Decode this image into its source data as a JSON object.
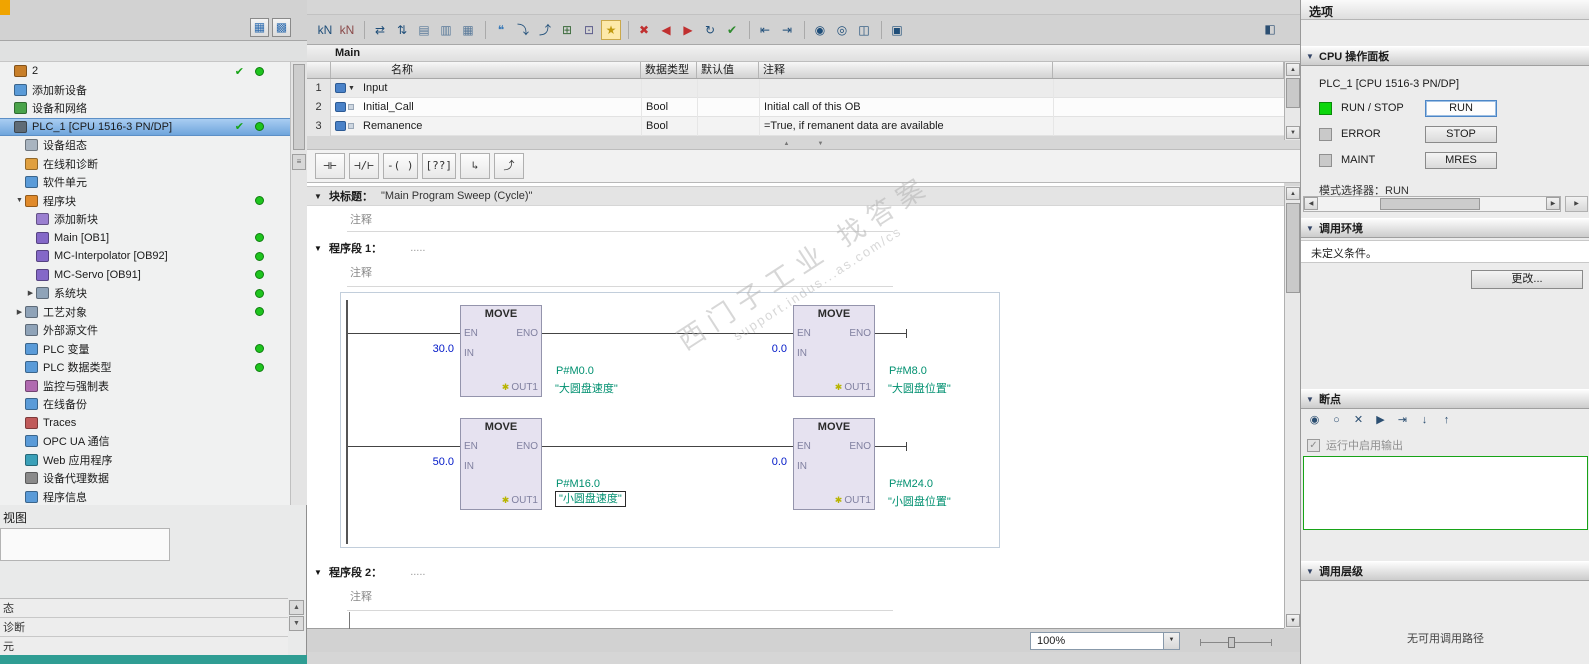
{
  "colors": {
    "accent_green": "#1ec41e",
    "selection_blue": "#6fa5dc",
    "operand_green": "#009070",
    "value_blue": "#0018c8",
    "block_fill": "#e6e2f0"
  },
  "left_panel": {
    "top_buttons": [
      {
        "name": "detail-view-toggle-button",
        "glyph": "▦"
      },
      {
        "name": "overview-toggle-button",
        "glyph": "▩"
      }
    ],
    "tree_items": [
      {
        "id": "project-root",
        "label": "2",
        "icon": "project",
        "indent": 0,
        "check": true,
        "dot": true
      },
      {
        "id": "add-new-device",
        "label": "添加新设备",
        "icon": "add-device",
        "indent": 0
      },
      {
        "id": "devices-networks",
        "label": "设备和网络",
        "icon": "network",
        "indent": 0
      },
      {
        "id": "plc-1",
        "label": "PLC_1 [CPU 1516-3 PN/DP]",
        "icon": "plc",
        "indent": 0,
        "selected": true,
        "check": true,
        "dot": true
      },
      {
        "id": "device-configuration",
        "label": "设备组态",
        "icon": "config",
        "indent": 1
      },
      {
        "id": "online-diagnostics",
        "label": "在线和诊断",
        "icon": "diag",
        "indent": 1
      },
      {
        "id": "software-units",
        "label": "软件单元",
        "icon": "unit",
        "indent": 1
      },
      {
        "id": "program-blocks",
        "label": "程序块",
        "icon": "folder-blocks",
        "indent": 1,
        "dot": true,
        "exp": "▼"
      },
      {
        "id": "add-new-block",
        "label": "添加新块",
        "icon": "add-block",
        "indent": 2
      },
      {
        "id": "main-ob1",
        "label": "Main [OB1]",
        "icon": "ob",
        "indent": 2,
        "dot": true
      },
      {
        "id": "mc-interpolator-ob92",
        "label": "MC-Interpolator [OB92]",
        "icon": "ob",
        "indent": 2,
        "dot": true
      },
      {
        "id": "mc-servo-ob91",
        "label": "MC-Servo [OB91]",
        "icon": "ob",
        "indent": 2,
        "dot": true
      },
      {
        "id": "system-blocks",
        "label": "系统块",
        "icon": "folder",
        "indent": 2,
        "dot": true,
        "exp": "▶"
      },
      {
        "id": "technology-objects",
        "label": "工艺对象",
        "icon": "folder-tech",
        "indent": 1,
        "dot": true,
        "exp": "▶"
      },
      {
        "id": "external-source-files",
        "label": "外部源文件",
        "icon": "folder-src",
        "indent": 1
      },
      {
        "id": "plc-tags",
        "label": "PLC 变量",
        "icon": "tags",
        "indent": 1,
        "dot": true
      },
      {
        "id": "plc-data-types",
        "label": "PLC 数据类型",
        "icon": "types",
        "indent": 1,
        "dot": true
      },
      {
        "id": "watch-force-tables",
        "label": "监控与强制表",
        "icon": "watch",
        "indent": 1
      },
      {
        "id": "online-backups",
        "label": "在线备份",
        "icon": "backup",
        "indent": 1
      },
      {
        "id": "traces",
        "label": "Traces",
        "icon": "traces",
        "indent": 1
      },
      {
        "id": "opc-ua-communication",
        "label": "OPC UA 通信",
        "icon": "opcua",
        "indent": 1
      },
      {
        "id": "web-applications",
        "label": "Web 应用程序",
        "icon": "web",
        "indent": 1
      },
      {
        "id": "device-proxy-data",
        "label": "设备代理数据",
        "icon": "proxy",
        "indent": 1
      },
      {
        "id": "program-info",
        "label": "程序信息",
        "icon": "info",
        "indent": 1
      }
    ],
    "detail_view_label": "视图",
    "bottom_rows": [
      "态",
      "诊断",
      "元"
    ]
  },
  "editor": {
    "title": "Main",
    "toolbar_icons": [
      {
        "name": "keep-actual-values-icon",
        "glyph": "kN",
        "color": "#1f4e79"
      },
      {
        "name": "discard-actual-values-icon",
        "glyph": "kN",
        "color": "#8a4a4a"
      },
      {
        "sep": true
      },
      {
        "name": "copy-snapshots-icon",
        "glyph": "⇄",
        "color": "#1f4e79"
      },
      {
        "name": "load-start-values-icon",
        "glyph": "⇅",
        "color": "#1f4e79"
      },
      {
        "name": "insert-row-icon",
        "glyph": "▤",
        "color": "#5a7a9a"
      },
      {
        "name": "add-row-icon",
        "glyph": "▥",
        "color": "#5a7a9a"
      },
      {
        "name": "absolute-symbolic-icon",
        "glyph": "▦",
        "color": "#5a7a9a"
      },
      {
        "sep": true
      },
      {
        "name": "comment-icon",
        "glyph": "❝",
        "color": "#3a7ab8"
      },
      {
        "name": "open-branch-icon",
        "glyph": "⤵",
        "color": "#1f4e79"
      },
      {
        "name": "close-branch-icon",
        "glyph": "⤴",
        "color": "#1f4e79"
      },
      {
        "name": "insert-network-icon",
        "glyph": "⊞",
        "color": "#3a6a3a"
      },
      {
        "name": "insert-empty-box-icon",
        "glyph": "⊡",
        "color": "#5a5a8a"
      },
      {
        "name": "favorites-icon",
        "glyph": "★",
        "color": "#c09a10",
        "active": true
      },
      {
        "sep": true
      },
      {
        "name": "go-to-error-icon",
        "glyph": "✖",
        "color": "#c03030"
      },
      {
        "name": "previous-error-icon",
        "glyph": "◀",
        "color": "#c03030"
      },
      {
        "name": "next-error-icon",
        "glyph": "▶",
        "color": "#c03030"
      },
      {
        "name": "update-block-calls-icon",
        "glyph": "↻",
        "color": "#1f4e79"
      },
      {
        "name": "consistency-check-icon",
        "glyph": "✔",
        "color": "#2e8b2e"
      },
      {
        "sep": true
      },
      {
        "name": "jump-back-icon",
        "glyph": "⇤",
        "color": "#1f4e79"
      },
      {
        "name": "jump-forward-icon",
        "glyph": "⇥",
        "color": "#1f4e79"
      },
      {
        "sep": true
      },
      {
        "name": "monitoring-on-off-icon",
        "glyph": "◉",
        "color": "#1f4e79"
      },
      {
        "name": "monitoring-pause-icon",
        "glyph": "◎",
        "color": "#1f4e79"
      },
      {
        "name": "call-environment-icon",
        "glyph": "◫",
        "color": "#1f4e79"
      },
      {
        "sep": true
      },
      {
        "name": "block-properties-icon",
        "glyph": "▣",
        "color": "#1f4e79"
      }
    ],
    "table": {
      "headers": [
        "名称",
        "数据类型",
        "默认值",
        "注释"
      ],
      "rows": [
        {
          "num": "1",
          "expand": true,
          "name": "Input",
          "type": "",
          "default": "",
          "comment": ""
        },
        {
          "num": "2",
          "name": "Initial_Call",
          "type": "Bool",
          "default": "",
          "comment": "Initial call of this OB"
        },
        {
          "num": "3",
          "name": "Remanence",
          "type": "Bool",
          "default": "",
          "comment": "=True, if remanent data are available"
        }
      ]
    },
    "lad_toolbar": [
      {
        "name": "no-contact-button",
        "glyph": "⊣⊢"
      },
      {
        "name": "nc-contact-button",
        "glyph": "⊣/⊢"
      },
      {
        "name": "coil-button",
        "glyph": "-( )"
      },
      {
        "name": "empty-box-button",
        "glyph": "[??]"
      },
      {
        "name": "open-branch-button",
        "glyph": "↳"
      },
      {
        "name": "close-branch-button",
        "glyph": "⤴"
      }
    ],
    "block_title_label": "块标题：",
    "block_title_value": "\"Main Program Sweep (Cycle)\"",
    "comment_text": "注释",
    "network1_label": "程序段 1：",
    "network2_label": "程序段 2：",
    "network_dots": ".....",
    "ladder_blocks": [
      {
        "title": "MOVE",
        "en": "EN",
        "eno": "ENO",
        "in": "IN",
        "out": "OUT1",
        "value": "30.0",
        "addr": "P#M0.0",
        "operand": "\"大圆盘速度\"",
        "editing": false
      },
      {
        "title": "MOVE",
        "en": "EN",
        "eno": "ENO",
        "in": "IN",
        "out": "OUT1",
        "value": "0.0",
        "addr": "P#M8.0",
        "operand": "\"大圆盘位置\"",
        "editing": false
      },
      {
        "title": "MOVE",
        "en": "EN",
        "eno": "ENO",
        "in": "IN",
        "out": "OUT1",
        "value": "50.0",
        "addr": "P#M16.0",
        "operand": "\"小圆盘速度\"",
        "editing": true
      },
      {
        "title": "MOVE",
        "en": "EN",
        "eno": "ENO",
        "in": "IN",
        "out": "OUT1",
        "value": "0.0",
        "addr": "P#M24.0",
        "operand": "\"小圆盘位置\"",
        "editing": false
      }
    ],
    "watermark_line1": "西门子工业 找答案",
    "watermark_line2": "support.indus...as.com/cs",
    "zoom_value": "100%"
  },
  "right_panel": {
    "title": "选项",
    "cpu_panel": {
      "title": "CPU 操作面板",
      "plc_label": "PLC_1 [CPU 1516-3 PN/DP]",
      "rows": [
        {
          "led": "green",
          "label": "RUN / STOP",
          "button": "RUN",
          "button_style": "primary"
        },
        {
          "led": "gray",
          "label": "ERROR",
          "button": "STOP",
          "button_style": "normal"
        },
        {
          "led": "gray",
          "label": "MAINT",
          "button": "MRES",
          "button_style": "normal"
        }
      ],
      "mode_label": "模式选择器：RUN"
    },
    "call_environment": {
      "title": "调用环境",
      "status_text": "未定义条件。",
      "change_button": "更改..."
    },
    "breakpoints": {
      "title": "断点",
      "toolbar_icons": [
        {
          "name": "activate-breakpoints-icon",
          "glyph": "◉"
        },
        {
          "name": "deactivate-breakpoints-icon",
          "glyph": "○"
        },
        {
          "name": "delete-breakpoints-icon",
          "glyph": "✕"
        },
        {
          "name": "next-breakpoint-icon",
          "glyph": "▶"
        },
        {
          "name": "step-over-icon",
          "glyph": "⇥"
        },
        {
          "name": "step-into-icon",
          "glyph": "↓"
        },
        {
          "name": "step-out-icon",
          "glyph": "↑"
        }
      ],
      "checkbox_label": "运行中启用输出",
      "checkbox_checked": true
    },
    "call_hierarchy": {
      "title": "调用层级",
      "empty_text": "无可用调用路径"
    }
  }
}
